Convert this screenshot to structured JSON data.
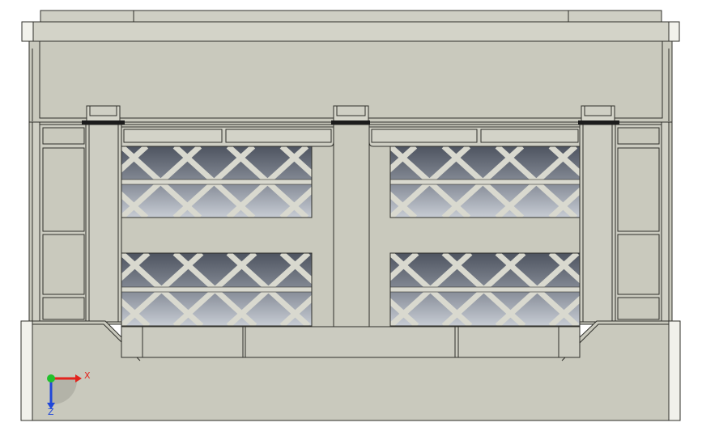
{
  "viewport": {
    "model": "folding crate",
    "view": "front",
    "colors": {
      "background": "#ffffff",
      "body": "#c9c9bd",
      "body_light": "#d6d6cb",
      "edge": "#2f2f2a",
      "grid_dark": "#5d636f",
      "grid_light": "#c2c7d0",
      "hinge": "#1c1c1c",
      "axis_x": "#e3231d",
      "axis_y": "#21c12b",
      "axis_z": "#1f47d9"
    }
  },
  "triad": {
    "x_label": "X",
    "z_label": "Z",
    "icon": "coordinate-triad-icon"
  }
}
